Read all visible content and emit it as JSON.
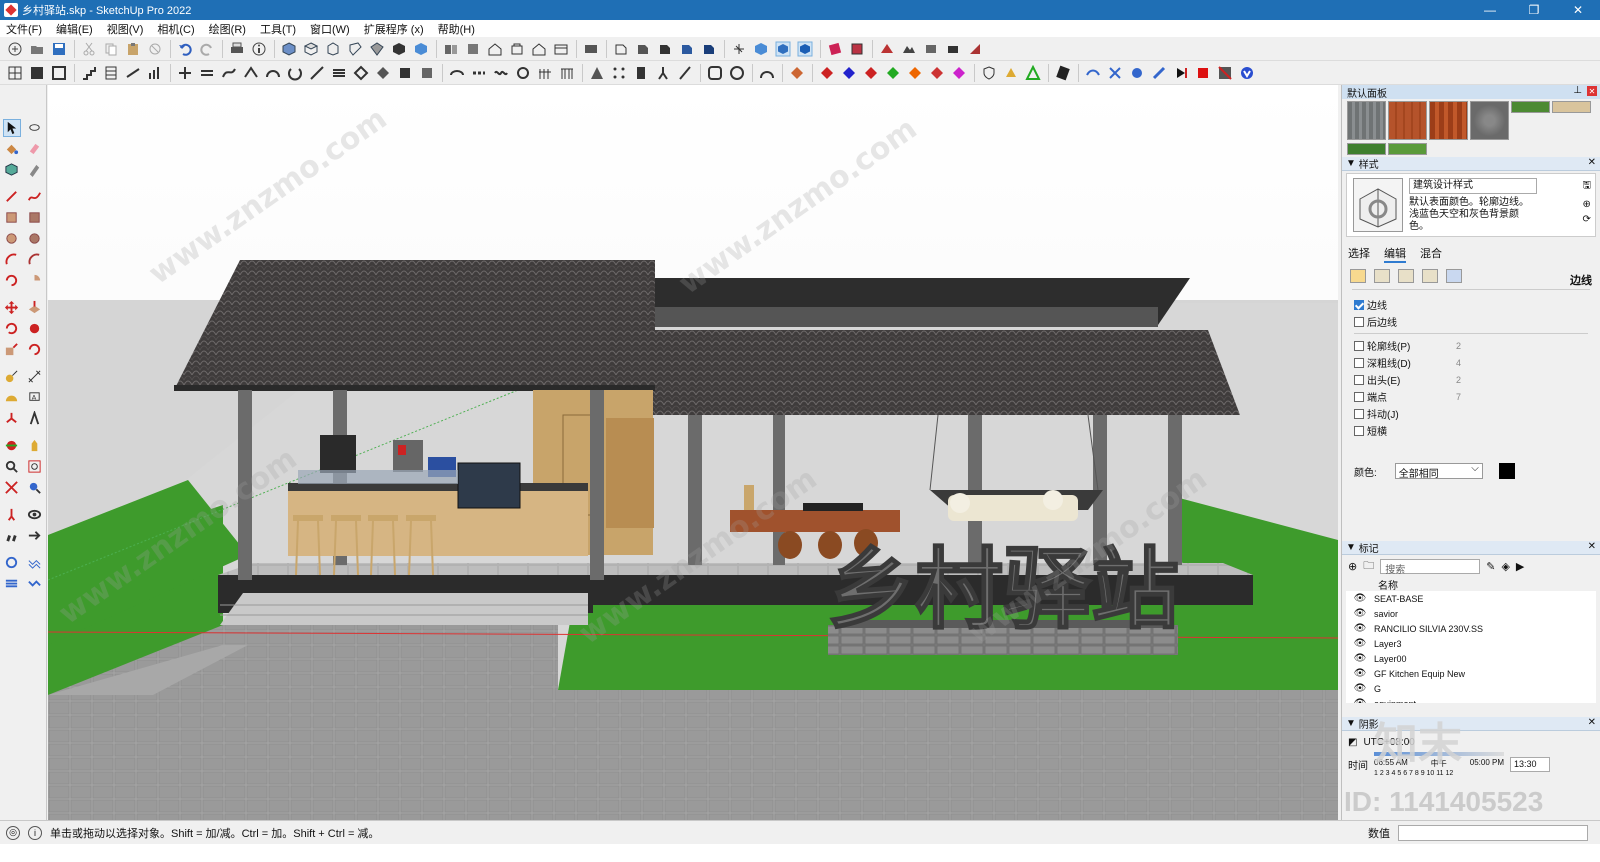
{
  "window": {
    "title": "乡村驿站.skp - SketchUp Pro 2022",
    "minimize": "—",
    "maximize": "❐",
    "close": "✕"
  },
  "menu": [
    "文件(F)",
    "编辑(E)",
    "视图(V)",
    "相机(C)",
    "绘图(R)",
    "工具(T)",
    "窗口(W)",
    "扩展程序 (x)",
    "帮助(H)"
  ],
  "scene": {
    "sign_text": "乡村驿站"
  },
  "panels": {
    "tray_title": "默认面板",
    "styles": {
      "header": "样式",
      "style_name": "建筑设计样式",
      "style_desc": "默认表面颜色。轮廓边线。浅蓝色天空和灰色背景颜色。",
      "tabs": [
        "选择",
        "编辑",
        "混合"
      ],
      "active_tab": "编辑",
      "section_label": "边线",
      "options": [
        {
          "label": "边线",
          "checked": true,
          "value": ""
        },
        {
          "label": "后边线",
          "checked": false,
          "value": ""
        },
        {
          "label": "轮廓线(P)",
          "checked": false,
          "value": "2"
        },
        {
          "label": "深粗线(D)",
          "checked": false,
          "value": "4"
        },
        {
          "label": "出头(E)",
          "checked": false,
          "value": "2"
        },
        {
          "label": "端点",
          "checked": false,
          "value": "7"
        },
        {
          "label": "抖动(J)",
          "checked": false,
          "value": ""
        },
        {
          "label": "短横",
          "checked": false,
          "value": ""
        }
      ],
      "color_label": "颜色:",
      "color_value": "全部相同",
      "color_hex": "#000000"
    },
    "tags": {
      "header": "标记",
      "search_placeholder": "搜索",
      "column_name": "名称",
      "items": [
        "SEAT-BASE",
        "savior",
        "RANCILIO SILVIA 230V.SS",
        "Layer3",
        "Layer00",
        "GF Kitchen Equip New",
        "G",
        "equipment"
      ]
    },
    "shadows": {
      "header": "阴影",
      "utc": "UTC+08:00",
      "time_label": "时间",
      "time_start": "06:55 AM",
      "time_mid": "中午",
      "time_end": "05:00 PM",
      "time_value": "13:30",
      "date_ticks": "1 2 3 4 5 6 7 8 9 10 11 12"
    }
  },
  "status": {
    "message": "单击或拖动以选择对象。Shift = 加/减。Ctrl = 加。Shift + Ctrl = 减。",
    "measure_label": "数值"
  },
  "watermarks": {
    "site": "www.znzmo.com",
    "logo": "知末",
    "id": "ID: 1141405523"
  },
  "colors": {
    "titlebar": "#1f6fb5",
    "sky": "#ffffff",
    "grass": "#3c9a2c",
    "pavement": "#9c9c9c",
    "roof": "#3e3b3b"
  }
}
